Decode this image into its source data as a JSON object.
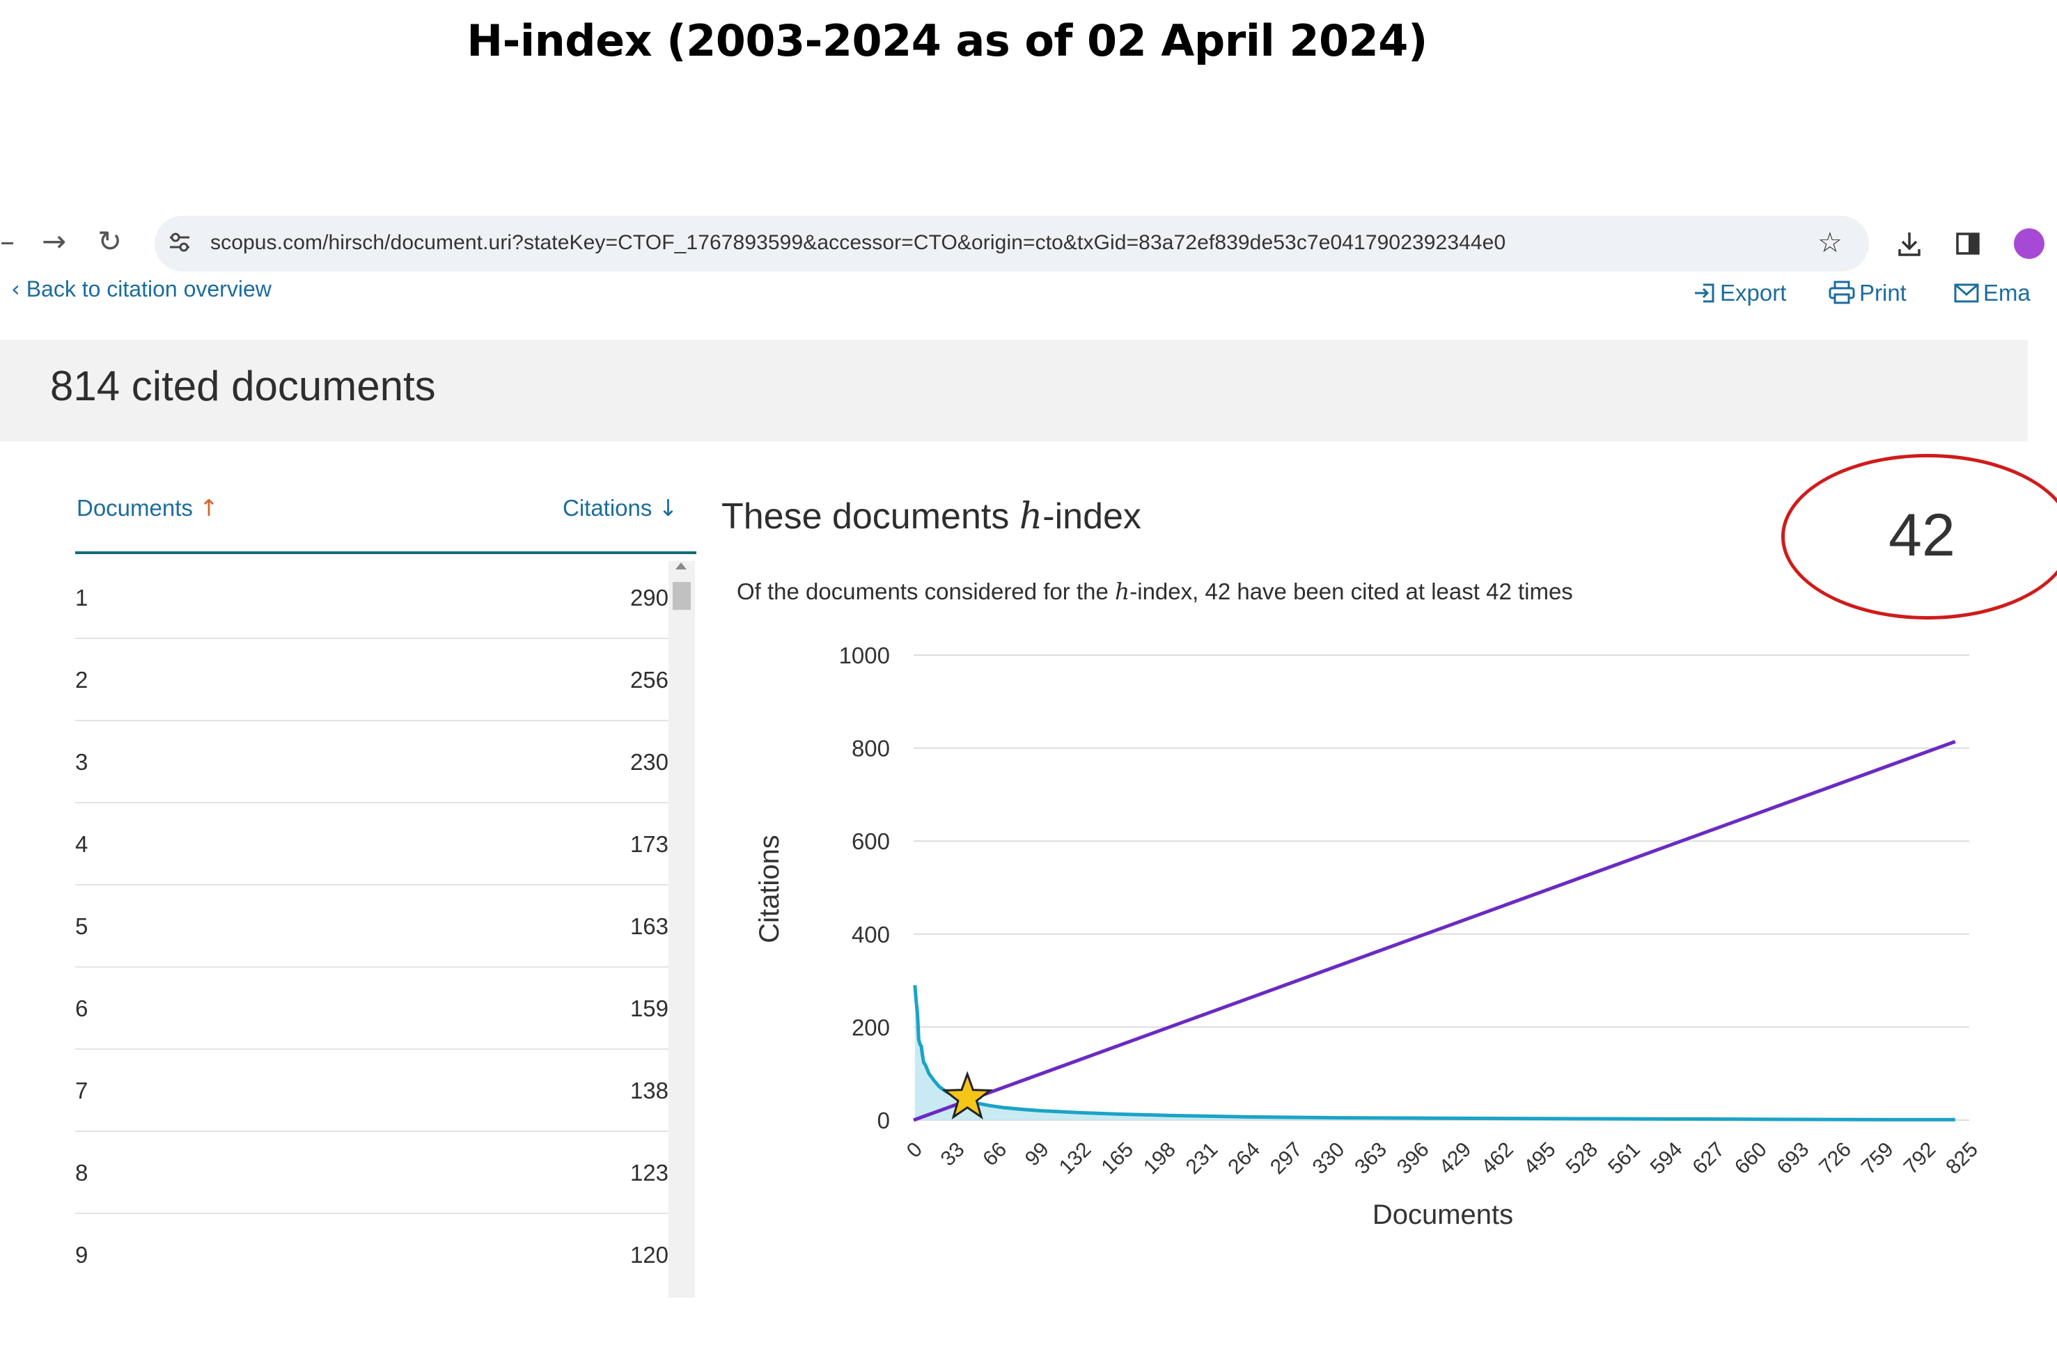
{
  "slide_title": "H-index (2003-2024 as of 02 April 2024)",
  "browser": {
    "back_icon": "back-arrow-icon",
    "forward_icon": "→",
    "reload_icon": "↻",
    "url": "scopus.com/hirsch/document.uri?stateKey=CTOF_1767893599&accessor=CTO&origin=cto&txGid=83a72ef839de53c7e0417902392344e0",
    "bookmark_icon": "☆"
  },
  "links": {
    "back": "Back to citation overview",
    "back_icon": "‹",
    "export": "Export",
    "print": "Print",
    "email": "Ema"
  },
  "header": {
    "title": "814 cited documents"
  },
  "table": {
    "col_documents": "Documents",
    "col_documents_arrow": "↑",
    "col_citations": "Citations",
    "col_citations_arrow": "↓",
    "rows": [
      {
        "idx": "1",
        "cit": "290"
      },
      {
        "idx": "2",
        "cit": "256"
      },
      {
        "idx": "3",
        "cit": "230"
      },
      {
        "idx": "4",
        "cit": "173"
      },
      {
        "idx": "5",
        "cit": "163"
      },
      {
        "idx": "6",
        "cit": "159"
      },
      {
        "idx": "7",
        "cit": "138"
      },
      {
        "idx": "8",
        "cit": "123"
      },
      {
        "idx": "9",
        "cit": "120"
      }
    ]
  },
  "panel": {
    "title_pre": "These documents ",
    "title_h": "h",
    "title_post": "-index",
    "desc_pre": "Of the documents considered for the ",
    "desc_h": "h",
    "desc_post": "-index, 42 have been cited at least 42 times",
    "h_value": "42"
  },
  "colors": {
    "link": "#1b6c9e",
    "citation_curve": "#1ba3c6",
    "citation_fill": "#bfe6f0",
    "diagonal": "#6a2bc2",
    "star": "#f5c518",
    "circle": "#d01b1b"
  },
  "chart_data": {
    "type": "line",
    "xlabel": "Documents",
    "ylabel": "Citations",
    "ylim": [
      0,
      1000
    ],
    "xlim": [
      0,
      825
    ],
    "yticks": [
      0,
      200,
      400,
      600,
      800,
      1000
    ],
    "xticks": [
      0,
      33,
      66,
      99,
      132,
      165,
      198,
      231,
      264,
      297,
      330,
      363,
      396,
      429,
      462,
      495,
      528,
      561,
      594,
      627,
      660,
      693,
      726,
      759,
      792,
      825
    ],
    "grid": true,
    "series": [
      {
        "points": [
          [
            1,
            290
          ],
          [
            2,
            256
          ],
          [
            3,
            230
          ],
          [
            4,
            173
          ],
          [
            5,
            163
          ],
          [
            6,
            159
          ],
          [
            7,
            138
          ],
          [
            8,
            123
          ],
          [
            9,
            120
          ],
          [
            12,
            100
          ],
          [
            16,
            85
          ],
          [
            20,
            72
          ],
          [
            25,
            62
          ],
          [
            30,
            55
          ],
          [
            35,
            49
          ],
          [
            40,
            44
          ],
          [
            42,
            42
          ],
          [
            50,
            36
          ],
          [
            60,
            31
          ],
          [
            70,
            27
          ],
          [
            85,
            23
          ],
          [
            100,
            20
          ],
          [
            130,
            16
          ],
          [
            160,
            13
          ],
          [
            200,
            10
          ],
          [
            260,
            7
          ],
          [
            330,
            5
          ],
          [
            420,
            4
          ],
          [
            520,
            3
          ],
          [
            640,
            2
          ],
          [
            760,
            1
          ],
          [
            814,
            1
          ]
        ]
      },
      {
        "points": [
          [
            0,
            0
          ],
          [
            814,
            814
          ]
        ]
      }
    ],
    "marker": {
      "shape": "star",
      "x": 42,
      "y": 42
    }
  }
}
